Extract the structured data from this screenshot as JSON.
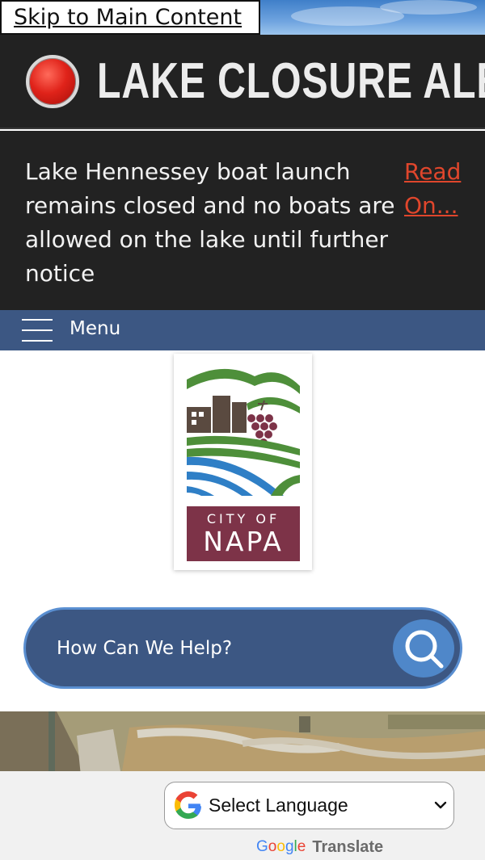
{
  "skip_link": {
    "label": "Skip to Main Content"
  },
  "alert": {
    "title": "LAKE CLOSURE ALERT",
    "message": "Lake Hennessey boat launch remains closed and no boats are allowed on the lake until further notice",
    "read_on": "Read On...",
    "icon": "alert-light-icon"
  },
  "nav": {
    "menu_label": "Menu",
    "icon": "hamburger-icon"
  },
  "logo": {
    "line1": "CITY OF",
    "line2": "NAPA"
  },
  "search": {
    "placeholder": "How Can We Help?",
    "icon": "search-icon"
  },
  "translate": {
    "select_value": "Select Language",
    "powered_brand": "Google",
    "powered_label": "Translate"
  },
  "colors": {
    "alert_bg": "#222222",
    "alert_link": "#e0462c",
    "nav_blue": "#3c5783",
    "search_button": "#4f87c9",
    "logo_maroon": "#7d3348",
    "logo_green": "#4e8f3a",
    "logo_blue": "#2f7fc6"
  }
}
